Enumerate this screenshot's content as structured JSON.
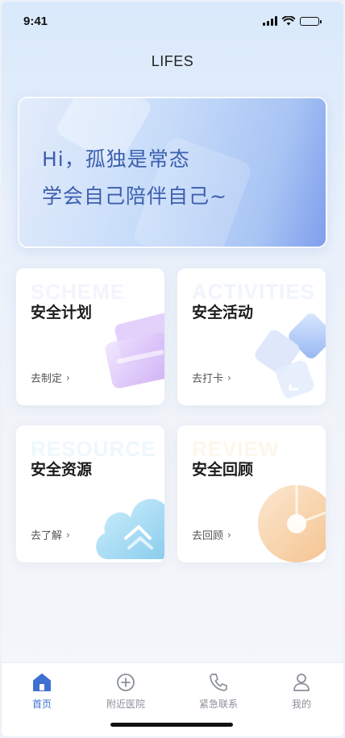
{
  "status_bar": {
    "time": "9:41"
  },
  "header": {
    "title": "LIFES"
  },
  "banner": {
    "line1": "Hi，孤独是常态",
    "line2": "学会自己陪伴自己~"
  },
  "cards": [
    {
      "bg_text": "SCHEME",
      "title": "安全计划",
      "link": "去制定",
      "accent": "#c9a6f2"
    },
    {
      "bg_text": "ACTIVITIES",
      "title": "安全活动",
      "link": "去打卡",
      "accent": "#9dbcf5"
    },
    {
      "bg_text": "RESOURCE",
      "title": "安全资源",
      "link": "去了解",
      "accent": "#8fd3f0"
    },
    {
      "bg_text": "REVIEW",
      "title": "安全回顾",
      "link": "去回顾",
      "accent": "#f6c79a"
    }
  ],
  "tabbar": {
    "items": [
      {
        "label": "首页",
        "icon": "home-icon",
        "active": true
      },
      {
        "label": "附近医院",
        "icon": "plus-circle-icon",
        "active": false
      },
      {
        "label": "紧急联系",
        "icon": "phone-icon",
        "active": false
      },
      {
        "label": "我的",
        "icon": "user-icon",
        "active": false
      }
    ],
    "active_color": "#3f6fd1",
    "inactive_color": "#8a8f99"
  }
}
